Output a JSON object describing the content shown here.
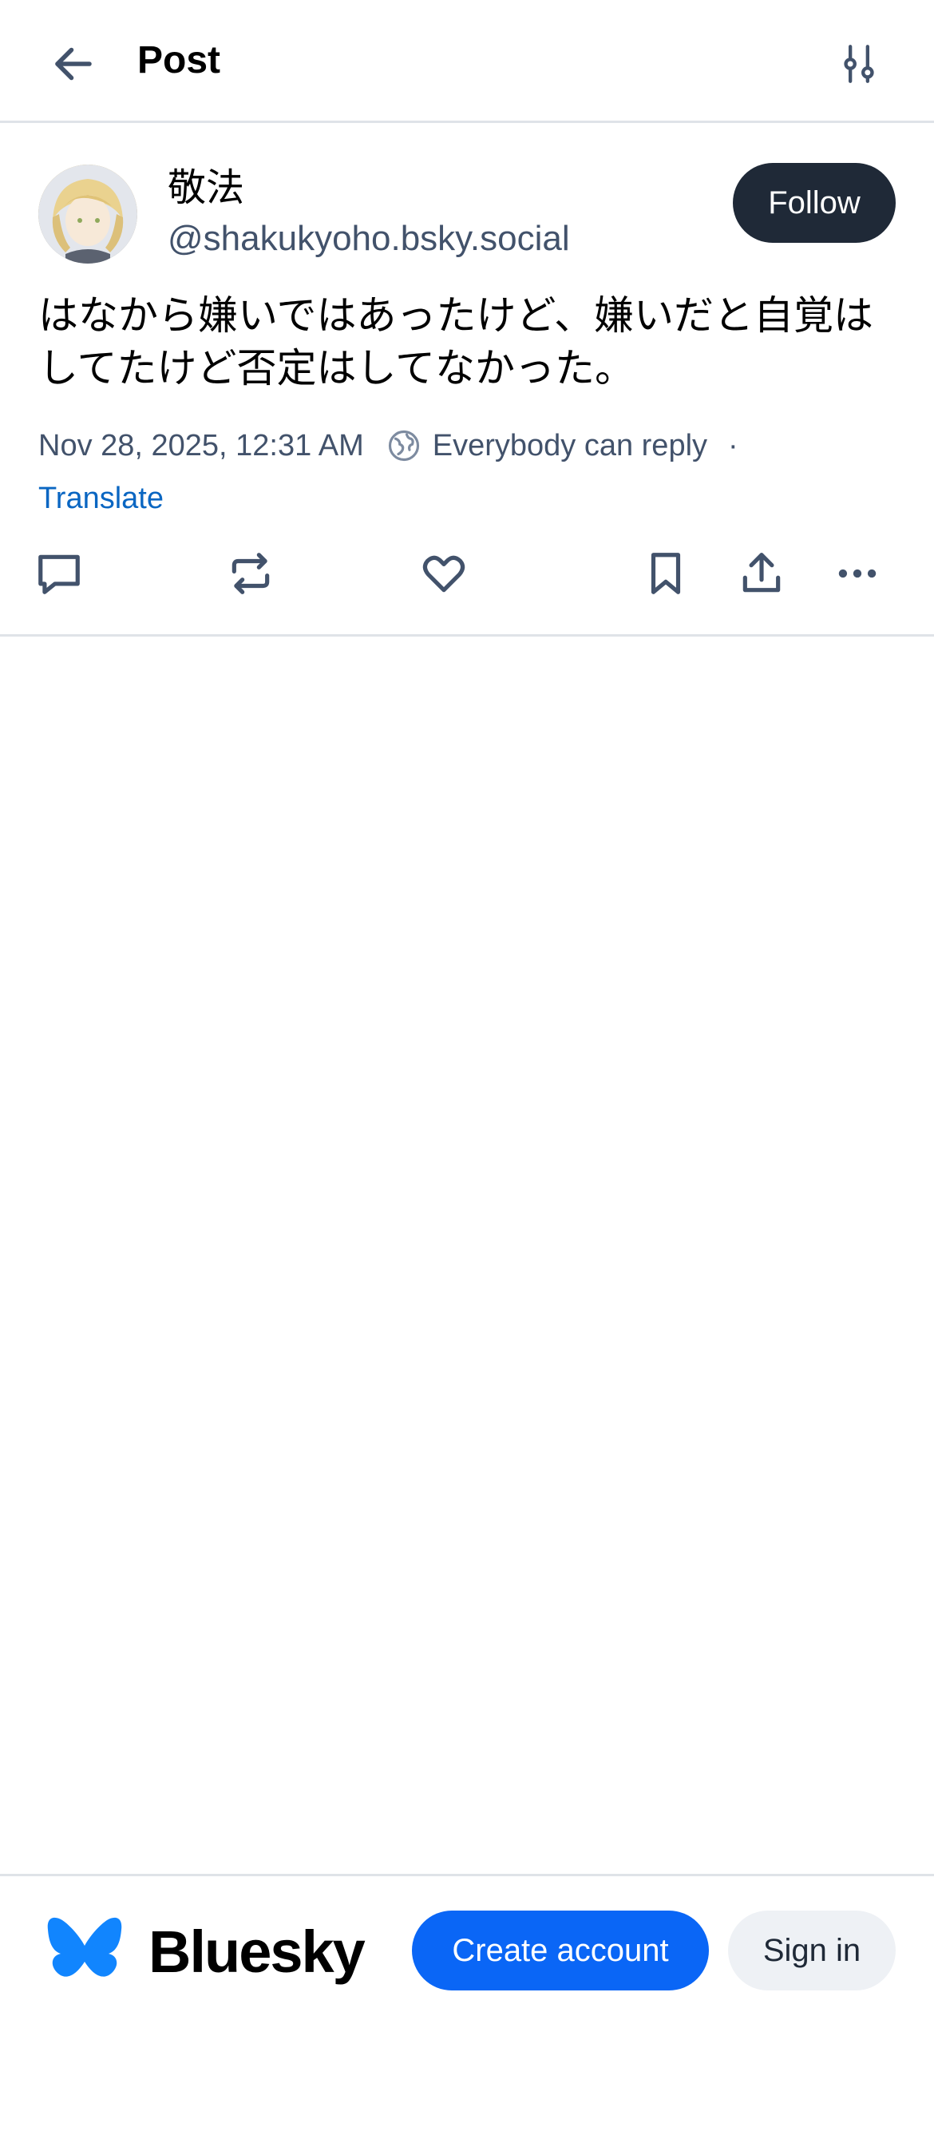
{
  "header": {
    "title": "Post",
    "back_icon": "arrow-left-icon",
    "filter_icon": "sliders-icon"
  },
  "post": {
    "author": {
      "display_name": "敬法",
      "handle": "@shakukyoho.bsky.social"
    },
    "follow_label": "Follow",
    "text": "はなから嫌いではあったけど、嫌いだと自覚はしてたけど否定はしてなかった。",
    "timestamp": "Nov 28, 2025, 12:31 AM",
    "reply_setting": "Everybody can reply",
    "separator": "·",
    "translate_label": "Translate",
    "actions": [
      "reply-icon",
      "repost-icon",
      "like-icon",
      "bookmark-icon",
      "share-icon",
      "more-icon"
    ]
  },
  "footer": {
    "brand": "Bluesky",
    "create_account_label": "Create account",
    "sign_in_label": "Sign in"
  },
  "colors": {
    "accent": "#0a66f6",
    "link": "#0a66c2",
    "muted_text": "#42526b",
    "dark_button": "#1f2937",
    "divider": "#dfe3e8",
    "signin_bg": "#eef1f5"
  }
}
